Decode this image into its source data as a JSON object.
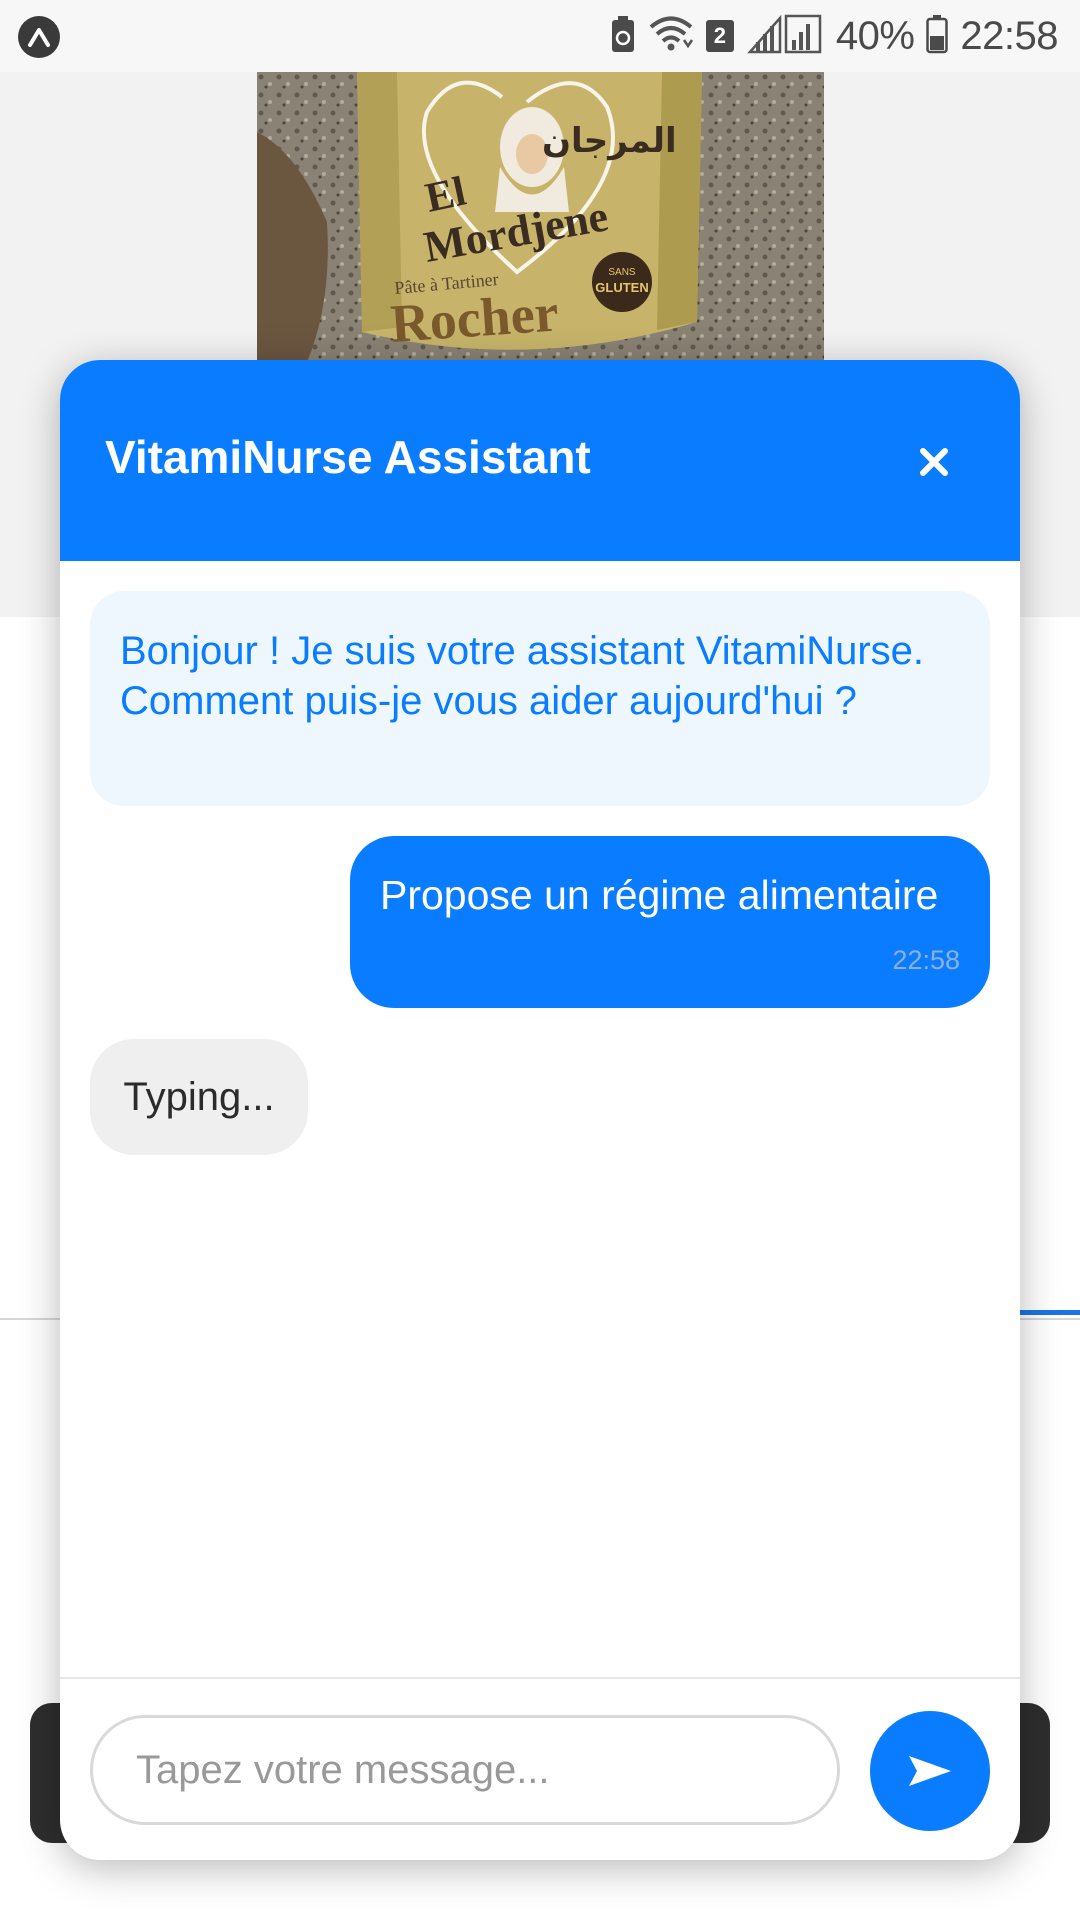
{
  "status_bar": {
    "battery_percent": "40%",
    "time": "22:58",
    "sim_slot": "2",
    "icons": [
      "app-logo-icon",
      "battery-saver-icon",
      "wifi-icon",
      "signal-icon",
      "battery-icon"
    ]
  },
  "background": {
    "product_image": {
      "brand_line1": "El",
      "brand_line2": "Mordjene",
      "arabic_brand": "المرجان",
      "subtitle": "Pâte à Tartiner",
      "product_name": "Rocher",
      "badge_line1": "SANS",
      "badge_line2": "GLUTEN"
    }
  },
  "chat": {
    "title": "VitamiNurse Assistant",
    "messages": [
      {
        "sender": "bot",
        "text": "Bonjour ! Je suis votre assistant VitamiNurse. Comment puis-je vous aider aujourd'hui ?"
      },
      {
        "sender": "user",
        "text": "Propose un régime alimentaire",
        "time": "22:58"
      }
    ],
    "typing_indicator": "Typing...",
    "input": {
      "value": "",
      "placeholder": "Tapez votre message..."
    }
  },
  "colors": {
    "primary": "#0a7cff",
    "bot_bubble_bg": "#eef6fe",
    "typing_bg": "#efefef"
  }
}
